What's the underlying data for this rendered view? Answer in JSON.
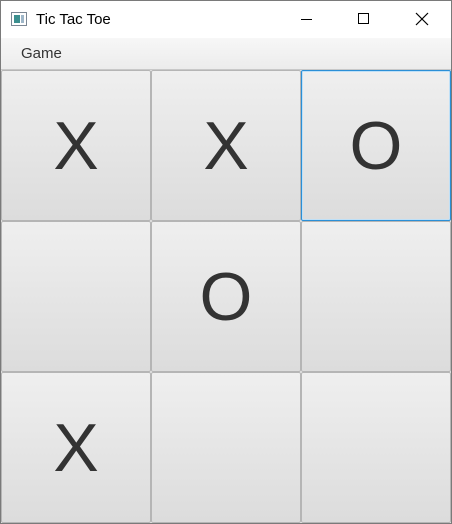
{
  "window": {
    "title": "Tic Tac Toe",
    "icon": "app-window-icon",
    "controls": [
      "minimize-icon",
      "maximize-icon",
      "close-icon"
    ]
  },
  "menubar": {
    "items": [
      {
        "label": "Game"
      }
    ]
  },
  "board": {
    "cells": [
      {
        "mark": "X",
        "focused": false
      },
      {
        "mark": "X",
        "focused": false
      },
      {
        "mark": "O",
        "focused": true
      },
      {
        "mark": "",
        "focused": false
      },
      {
        "mark": "O",
        "focused": false
      },
      {
        "mark": "",
        "focused": false
      },
      {
        "mark": "X",
        "focused": false
      },
      {
        "mark": "",
        "focused": false
      },
      {
        "mark": "",
        "focused": false
      }
    ]
  },
  "colors": {
    "mark": "#333333",
    "focus_border": "#2b8fd6",
    "cell_gradient_top": "#efefef",
    "cell_gradient_bottom": "#dcdcdc"
  }
}
